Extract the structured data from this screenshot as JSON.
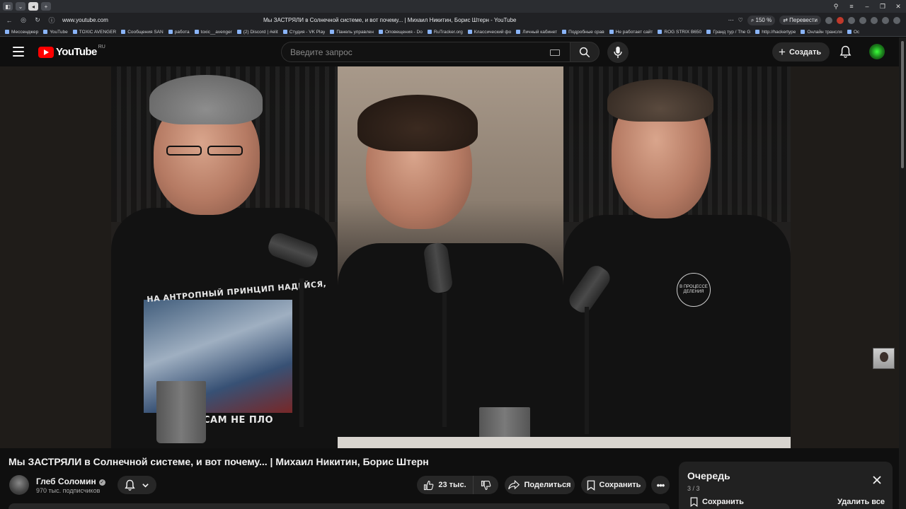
{
  "browser": {
    "url": "www.youtube.com",
    "page_title": "Мы ЗАСТРЯЛИ в Солнечной системе, и вот почему... | Михаил Никитин, Борис Штерн - YouTube",
    "zoom": "150 %",
    "translate_label": "Перевести",
    "bookmarks": [
      "Мессенджер",
      "YouTube",
      "TOXIC AVENGER",
      "Сообщения SAN",
      "работа",
      "toxic__avenger",
      "(2) Discord | #elit",
      "Студия - VK Play",
      "Панель управлен",
      "Оповещения - Do",
      "RuTracker.org",
      "Классический фо",
      "Личный кабинет",
      "Подробные срав",
      "Не работает сайт",
      "ROG STRIX B650E",
      "Гранд тур / The G",
      "http://hackertype",
      "Онлайн трансля",
      "Ос"
    ]
  },
  "header": {
    "logo_text": "YouTube",
    "region": "RU",
    "search_placeholder": "Введите запрос",
    "create_label": "Создать"
  },
  "player": {
    "shirt_text_1": "НА АНТРОПНЫЙ ПРИНЦИП НАДЕЙСЯ,",
    "shirt_text_2": "САМ НЕ ПЛО",
    "shirt_badge": "В ПРОЦЕССЕ ДЕЛЕНИЯ"
  },
  "video": {
    "title": "Мы ЗАСТРЯЛИ в Солнечной системе, и вот почему... | Михаил Никитин, Борис Штерн",
    "channel": "Глеб Соломин",
    "subscribers": "970 тыс. подписчиков",
    "likes": "23 тыс.",
    "share_label": "Поделиться",
    "save_label": "Сохранить"
  },
  "queue": {
    "title": "Очередь",
    "count": "3 / 3",
    "save_label": "Сохранить",
    "clear_label": "Удалить все"
  },
  "colors": {
    "background": "#0f0f0f",
    "button": "#272727",
    "brand": "#ff0000",
    "text": "#f1f1f1",
    "muted": "#aaaaaa"
  }
}
